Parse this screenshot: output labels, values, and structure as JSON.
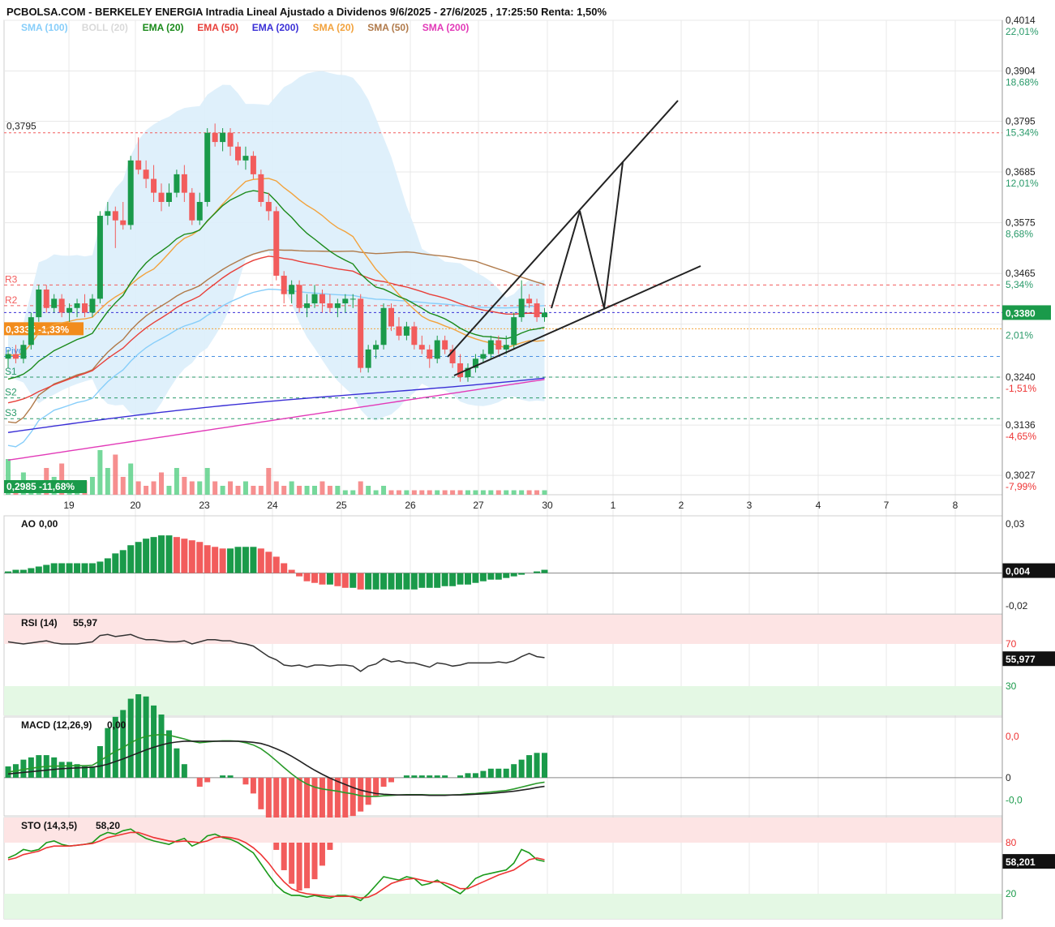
{
  "header": {
    "title": "PCBOLSA.COM - BERKELEY ENERGIA Intradia Lineal Ajustado a Dividenos 9/6/2025 - 27/6/2025 , 17:25:50 Renta: 1,50%"
  },
  "legend": [
    {
      "label": "SMA (100)",
      "color": "#87cefa"
    },
    {
      "label": "BOLL (20)",
      "color": "#d9d9d9"
    },
    {
      "label": "EMA (20)",
      "color": "#1a8a1a"
    },
    {
      "label": "EMA (50)",
      "color": "#e8403a"
    },
    {
      "label": "EMA (200)",
      "color": "#3a2fd6"
    },
    {
      "label": "SMA (20)",
      "color": "#f2a23c"
    },
    {
      "label": "SMA (50)",
      "color": "#b07a4a"
    },
    {
      "label": "SMA (200)",
      "color": "#e23ab8"
    }
  ],
  "colors": {
    "up": "#1a9a4a",
    "down": "#f25c5c",
    "grid": "#e8e8e8",
    "boll_fill": "#dbeefb"
  },
  "chart_data": [
    {
      "type": "candlestick",
      "title": "PCBOLSA.COM - BERKELEY ENERGIA Intradia Lineal Ajustado a Dividenos 9/6/2025 - 27/6/2025",
      "x_ticks": [
        "19",
        "20",
        "23",
        "24",
        "25",
        "26",
        "27",
        "30",
        "1",
        "2",
        "3",
        "4",
        "7",
        "8"
      ],
      "ylim": [
        0.2985,
        0.4014
      ],
      "price_ticks": [
        {
          "value": 0.4014,
          "label": "0,4014",
          "pct": "22,01%"
        },
        {
          "value": 0.3904,
          "label": "0,3904",
          "pct": "18,68%"
        },
        {
          "value": 0.3795,
          "label": "0,3795",
          "pct": "15,34%"
        },
        {
          "value": 0.3685,
          "label": "0,3685",
          "pct": "12,01%"
        },
        {
          "value": 0.3575,
          "label": "0,3575",
          "pct": "8,68%"
        },
        {
          "value": 0.3465,
          "label": "0,3465",
          "pct": "5,34%"
        },
        {
          "value": 0.3355,
          "label": "",
          "pct": "2,01%"
        },
        {
          "value": 0.324,
          "label": "0,3240",
          "pct": "-1,51%"
        },
        {
          "value": 0.3136,
          "label": "0,3136",
          "pct": "-4,65%"
        },
        {
          "value": 0.3027,
          "label": "0,3027",
          "pct": "-7,99%"
        }
      ],
      "last_price": {
        "label": "0,3380",
        "value": 0.338
      },
      "max_label": "0,3795",
      "min_label": "0,2985 -11,68%",
      "ref_price_label": "0,3335 -1,33%",
      "pivot_levels": [
        {
          "label": "R3",
          "value": 0.344,
          "color": "#f25c5c"
        },
        {
          "label": "R2",
          "value": 0.3395,
          "color": "#f25c5c"
        },
        {
          "label": "Pivot",
          "value": 0.3285,
          "color": "#4a90e2"
        },
        {
          "label": "S1",
          "value": 0.324,
          "color": "#2a9a6a"
        },
        {
          "label": "S2",
          "value": 0.3195,
          "color": "#2a9a6a"
        },
        {
          "label": "S3",
          "value": 0.315,
          "color": "#2a9a6a"
        }
      ],
      "candles": [
        [
          0.328,
          0.33,
          0.326,
          0.329
        ],
        [
          0.329,
          0.331,
          0.327,
          0.328
        ],
        [
          0.328,
          0.332,
          0.327,
          0.331
        ],
        [
          0.331,
          0.338,
          0.33,
          0.337
        ],
        [
          0.337,
          0.344,
          0.336,
          0.343
        ],
        [
          0.343,
          0.344,
          0.338,
          0.339
        ],
        [
          0.339,
          0.342,
          0.338,
          0.341
        ],
        [
          0.341,
          0.342,
          0.337,
          0.338
        ],
        [
          0.338,
          0.34,
          0.336,
          0.339
        ],
        [
          0.339,
          0.341,
          0.337,
          0.34
        ],
        [
          0.34,
          0.342,
          0.337,
          0.338
        ],
        [
          0.338,
          0.342,
          0.337,
          0.341
        ],
        [
          0.341,
          0.36,
          0.34,
          0.359
        ],
        [
          0.359,
          0.362,
          0.357,
          0.36
        ],
        [
          0.36,
          0.361,
          0.352,
          0.358
        ],
        [
          0.358,
          0.362,
          0.356,
          0.357
        ],
        [
          0.357,
          0.372,
          0.356,
          0.371
        ],
        [
          0.371,
          0.376,
          0.368,
          0.369
        ],
        [
          0.369,
          0.371,
          0.365,
          0.367
        ],
        [
          0.367,
          0.37,
          0.362,
          0.364
        ],
        [
          0.364,
          0.366,
          0.36,
          0.362
        ],
        [
          0.362,
          0.366,
          0.361,
          0.364
        ],
        [
          0.364,
          0.369,
          0.363,
          0.368
        ],
        [
          0.368,
          0.37,
          0.362,
          0.364
        ],
        [
          0.364,
          0.365,
          0.357,
          0.358
        ],
        [
          0.358,
          0.364,
          0.357,
          0.362
        ],
        [
          0.362,
          0.378,
          0.361,
          0.377
        ],
        [
          0.377,
          0.379,
          0.374,
          0.375
        ],
        [
          0.375,
          0.378,
          0.373,
          0.377
        ],
        [
          0.377,
          0.378,
          0.372,
          0.374
        ],
        [
          0.374,
          0.375,
          0.37,
          0.371
        ],
        [
          0.371,
          0.374,
          0.369,
          0.372
        ],
        [
          0.372,
          0.373,
          0.367,
          0.368
        ],
        [
          0.368,
          0.369,
          0.361,
          0.362
        ],
        [
          0.362,
          0.364,
          0.358,
          0.36
        ],
        [
          0.36,
          0.361,
          0.345,
          0.346
        ],
        [
          0.346,
          0.347,
          0.34,
          0.342
        ],
        [
          0.342,
          0.345,
          0.34,
          0.344
        ],
        [
          0.344,
          0.345,
          0.338,
          0.339
        ],
        [
          0.339,
          0.342,
          0.337,
          0.34
        ],
        [
          0.34,
          0.344,
          0.339,
          0.342
        ],
        [
          0.342,
          0.343,
          0.338,
          0.34
        ],
        [
          0.34,
          0.342,
          0.338,
          0.339
        ],
        [
          0.339,
          0.341,
          0.337,
          0.34
        ],
        [
          0.34,
          0.342,
          0.338,
          0.341
        ],
        [
          0.341,
          0.342,
          0.339,
          0.341
        ],
        [
          0.341,
          0.342,
          0.325,
          0.326
        ],
        [
          0.326,
          0.331,
          0.325,
          0.33
        ],
        [
          0.33,
          0.332,
          0.328,
          0.331
        ],
        [
          0.331,
          0.34,
          0.33,
          0.339
        ],
        [
          0.339,
          0.34,
          0.334,
          0.335
        ],
        [
          0.335,
          0.337,
          0.332,
          0.333
        ],
        [
          0.333,
          0.336,
          0.332,
          0.335
        ],
        [
          0.335,
          0.336,
          0.33,
          0.331
        ],
        [
          0.331,
          0.333,
          0.329,
          0.33
        ],
        [
          0.33,
          0.331,
          0.326,
          0.328
        ],
        [
          0.328,
          0.333,
          0.327,
          0.332
        ],
        [
          0.332,
          0.333,
          0.329,
          0.33
        ],
        [
          0.33,
          0.331,
          0.326,
          0.327
        ],
        [
          0.327,
          0.329,
          0.323,
          0.324
        ],
        [
          0.324,
          0.327,
          0.323,
          0.326
        ],
        [
          0.326,
          0.329,
          0.325,
          0.328
        ],
        [
          0.328,
          0.33,
          0.327,
          0.329
        ],
        [
          0.329,
          0.333,
          0.328,
          0.332
        ],
        [
          0.332,
          0.333,
          0.329,
          0.33
        ],
        [
          0.33,
          0.333,
          0.329,
          0.331
        ],
        [
          0.331,
          0.338,
          0.33,
          0.337
        ],
        [
          0.337,
          0.345,
          0.336,
          0.341
        ],
        [
          0.341,
          0.342,
          0.339,
          0.34
        ],
        [
          0.34,
          0.341,
          0.336,
          0.337
        ],
        [
          0.337,
          0.339,
          0.336,
          0.338
        ]
      ],
      "volume_rel": [
        0.8,
        0.2,
        0.5,
        0.3,
        0.3,
        0.6,
        0.4,
        0.7,
        0.3,
        0.2,
        0.3,
        0.4,
        1.0,
        0.6,
        0.9,
        0.4,
        0.7,
        0.3,
        0.2,
        0.3,
        0.5,
        0.2,
        0.6,
        0.4,
        0.3,
        0.3,
        0.6,
        0.3,
        0.2,
        0.3,
        0.2,
        0.3,
        0.2,
        0.2,
        0.6,
        0.3,
        0.2,
        0.3,
        0.2,
        0.2,
        0.2,
        0.3,
        0.2,
        0.2,
        0.1,
        0.1,
        0.3,
        0.2,
        0.1,
        0.2,
        0.1,
        0.1,
        0.1,
        0.1,
        0.1,
        0.1,
        0.1,
        0.1,
        0.1,
        0.1,
        0.1,
        0.1,
        0.1,
        0.1,
        0.1,
        0.1,
        0.1,
        0.1,
        0.1,
        0.1,
        0.1
      ]
    },
    {
      "type": "bar",
      "indicator": "AO",
      "label": "AO",
      "value_label": "0,00",
      "ylim": [
        -0.02,
        0.03
      ],
      "ticks": [
        {
          "v": 0.03,
          "label": "0,03"
        },
        {
          "v": -0.02,
          "label": "-0,02"
        }
      ],
      "last_label": "0,004",
      "values": [
        0.001,
        0.002,
        0.002,
        0.003,
        0.004,
        0.005,
        0.006,
        0.006,
        0.006,
        0.006,
        0.006,
        0.006,
        0.007,
        0.009,
        0.012,
        0.014,
        0.017,
        0.019,
        0.021,
        0.022,
        0.023,
        0.023,
        0.022,
        0.021,
        0.02,
        0.019,
        0.017,
        0.016,
        0.015,
        0.015,
        0.016,
        0.016,
        0.016,
        0.015,
        0.013,
        0.01,
        0.006,
        0.002,
        -0.002,
        -0.005,
        -0.006,
        -0.007,
        -0.007,
        -0.008,
        -0.009,
        -0.009,
        -0.01,
        -0.01,
        -0.01,
        -0.01,
        -0.01,
        -0.01,
        -0.01,
        -0.01,
        -0.009,
        -0.009,
        -0.009,
        -0.008,
        -0.008,
        -0.007,
        -0.007,
        -0.006,
        -0.005,
        -0.004,
        -0.004,
        -0.003,
        -0.002,
        -0.001,
        0.0,
        0.001,
        0.002
      ]
    },
    {
      "type": "line",
      "indicator": "RSI",
      "label": "RSI (14)",
      "value_label": "55,97",
      "ylim": [
        10,
        90
      ],
      "ticks": [
        {
          "v": 70,
          "label": "70"
        },
        {
          "v": 30,
          "label": "30"
        }
      ],
      "last_label": "55,977",
      "values": [
        72,
        71,
        70,
        71,
        72,
        73,
        71,
        70,
        70,
        70,
        71,
        72,
        78,
        79,
        77,
        78,
        79,
        76,
        74,
        74,
        73,
        72,
        72,
        73,
        70,
        72,
        74,
        74,
        73,
        73,
        71,
        70,
        68,
        63,
        58,
        55,
        50,
        49,
        50,
        48,
        50,
        50,
        49,
        50,
        50,
        49,
        44,
        49,
        51,
        56,
        53,
        54,
        52,
        52,
        50,
        48,
        52,
        51,
        49,
        50,
        52,
        52,
        52,
        52,
        53,
        52,
        54,
        58,
        61,
        58,
        57
      ]
    },
    {
      "type": "line",
      "indicator": "MACD",
      "label": "MACD (12,26,9)",
      "value_label": "0,00",
      "ylim": [
        -0.008,
        0.014
      ],
      "ticks": [
        {
          "v": 0.011,
          "label": "0,0"
        },
        {
          "v": 0.0,
          "label": "0"
        },
        {
          "v": -0.006,
          "label": "-0,0"
        }
      ],
      "macd": [
        0.0015,
        0.0018,
        0.0022,
        0.0025,
        0.0028,
        0.003,
        0.0031,
        0.0031,
        0.0032,
        0.0032,
        0.0032,
        0.0033,
        0.0045,
        0.0058,
        0.007,
        0.008,
        0.0093,
        0.0103,
        0.011,
        0.0113,
        0.0115,
        0.0113,
        0.0108,
        0.0103,
        0.0097,
        0.0093,
        0.0095,
        0.0097,
        0.0098,
        0.0098,
        0.0097,
        0.0093,
        0.0087,
        0.0077,
        0.0062,
        0.0045,
        0.0027,
        0.001,
        -0.0005,
        -0.0017,
        -0.0025,
        -0.003,
        -0.0033,
        -0.0036,
        -0.004,
        -0.0043,
        -0.0048,
        -0.005,
        -0.005,
        -0.0048,
        -0.0047,
        -0.0046,
        -0.0045,
        -0.0045,
        -0.0045,
        -0.0046,
        -0.0046,
        -0.0046,
        -0.0046,
        -0.0045,
        -0.0043,
        -0.0042,
        -0.004,
        -0.0038,
        -0.0036,
        -0.0034,
        -0.003,
        -0.0025,
        -0.002,
        -0.0015,
        -0.0012
      ],
      "signal": [
        0.001,
        0.0012,
        0.0014,
        0.0016,
        0.0018,
        0.002,
        0.0022,
        0.0024,
        0.0025,
        0.0026,
        0.0027,
        0.0028,
        0.0031,
        0.0036,
        0.0043,
        0.005,
        0.0058,
        0.0066,
        0.0074,
        0.0081,
        0.0087,
        0.0092,
        0.0095,
        0.0097,
        0.0097,
        0.0097,
        0.0097,
        0.0097,
        0.0097,
        0.0097,
        0.0097,
        0.0096,
        0.0094,
        0.0091,
        0.0085,
        0.0077,
        0.0068,
        0.0057,
        0.0045,
        0.0032,
        0.002,
        0.0009,
        -0.0001,
        -0.001,
        -0.0018,
        -0.0026,
        -0.0033,
        -0.0038,
        -0.0042,
        -0.0044,
        -0.0045,
        -0.0046,
        -0.0046,
        -0.0046,
        -0.0046,
        -0.0047,
        -0.0047,
        -0.0047,
        -0.0046,
        -0.0046,
        -0.0045,
        -0.0044,
        -0.0043,
        -0.0042,
        -0.004,
        -0.0038,
        -0.0036,
        -0.0033,
        -0.003,
        -0.0026,
        -0.0023
      ]
    },
    {
      "type": "line",
      "indicator": "STO",
      "label": "STO (14,3,5)",
      "value_label": "58,20",
      "ylim": [
        0,
        100
      ],
      "ticks": [
        {
          "v": 80,
          "label": "80"
        },
        {
          "v": 20,
          "label": "20"
        }
      ],
      "last_label": "58,201",
      "k": [
        62,
        66,
        72,
        70,
        72,
        80,
        82,
        78,
        76,
        77,
        78,
        80,
        88,
        92,
        90,
        94,
        96,
        90,
        85,
        82,
        80,
        78,
        82,
        85,
        76,
        80,
        88,
        90,
        86,
        84,
        80,
        74,
        68,
        55,
        42,
        30,
        22,
        18,
        18,
        16,
        18,
        16,
        15,
        18,
        18,
        16,
        12,
        20,
        30,
        40,
        38,
        36,
        40,
        38,
        30,
        32,
        36,
        30,
        25,
        20,
        28,
        38,
        42,
        44,
        46,
        48,
        56,
        72,
        68,
        60,
        58
      ],
      "d": [
        60,
        62,
        66,
        68,
        70,
        74,
        76,
        76,
        76,
        77,
        78,
        79,
        82,
        86,
        88,
        90,
        92,
        92,
        89,
        86,
        84,
        82,
        81,
        82,
        81,
        80,
        82,
        86,
        87,
        86,
        84,
        80,
        74,
        66,
        56,
        44,
        34,
        26,
        22,
        20,
        19,
        18,
        17,
        17,
        17,
        17,
        15,
        16,
        20,
        26,
        32,
        35,
        37,
        38,
        36,
        34,
        34,
        33,
        30,
        26,
        26,
        30,
        34,
        38,
        42,
        45,
        48,
        54,
        60,
        62,
        60
      ]
    }
  ]
}
